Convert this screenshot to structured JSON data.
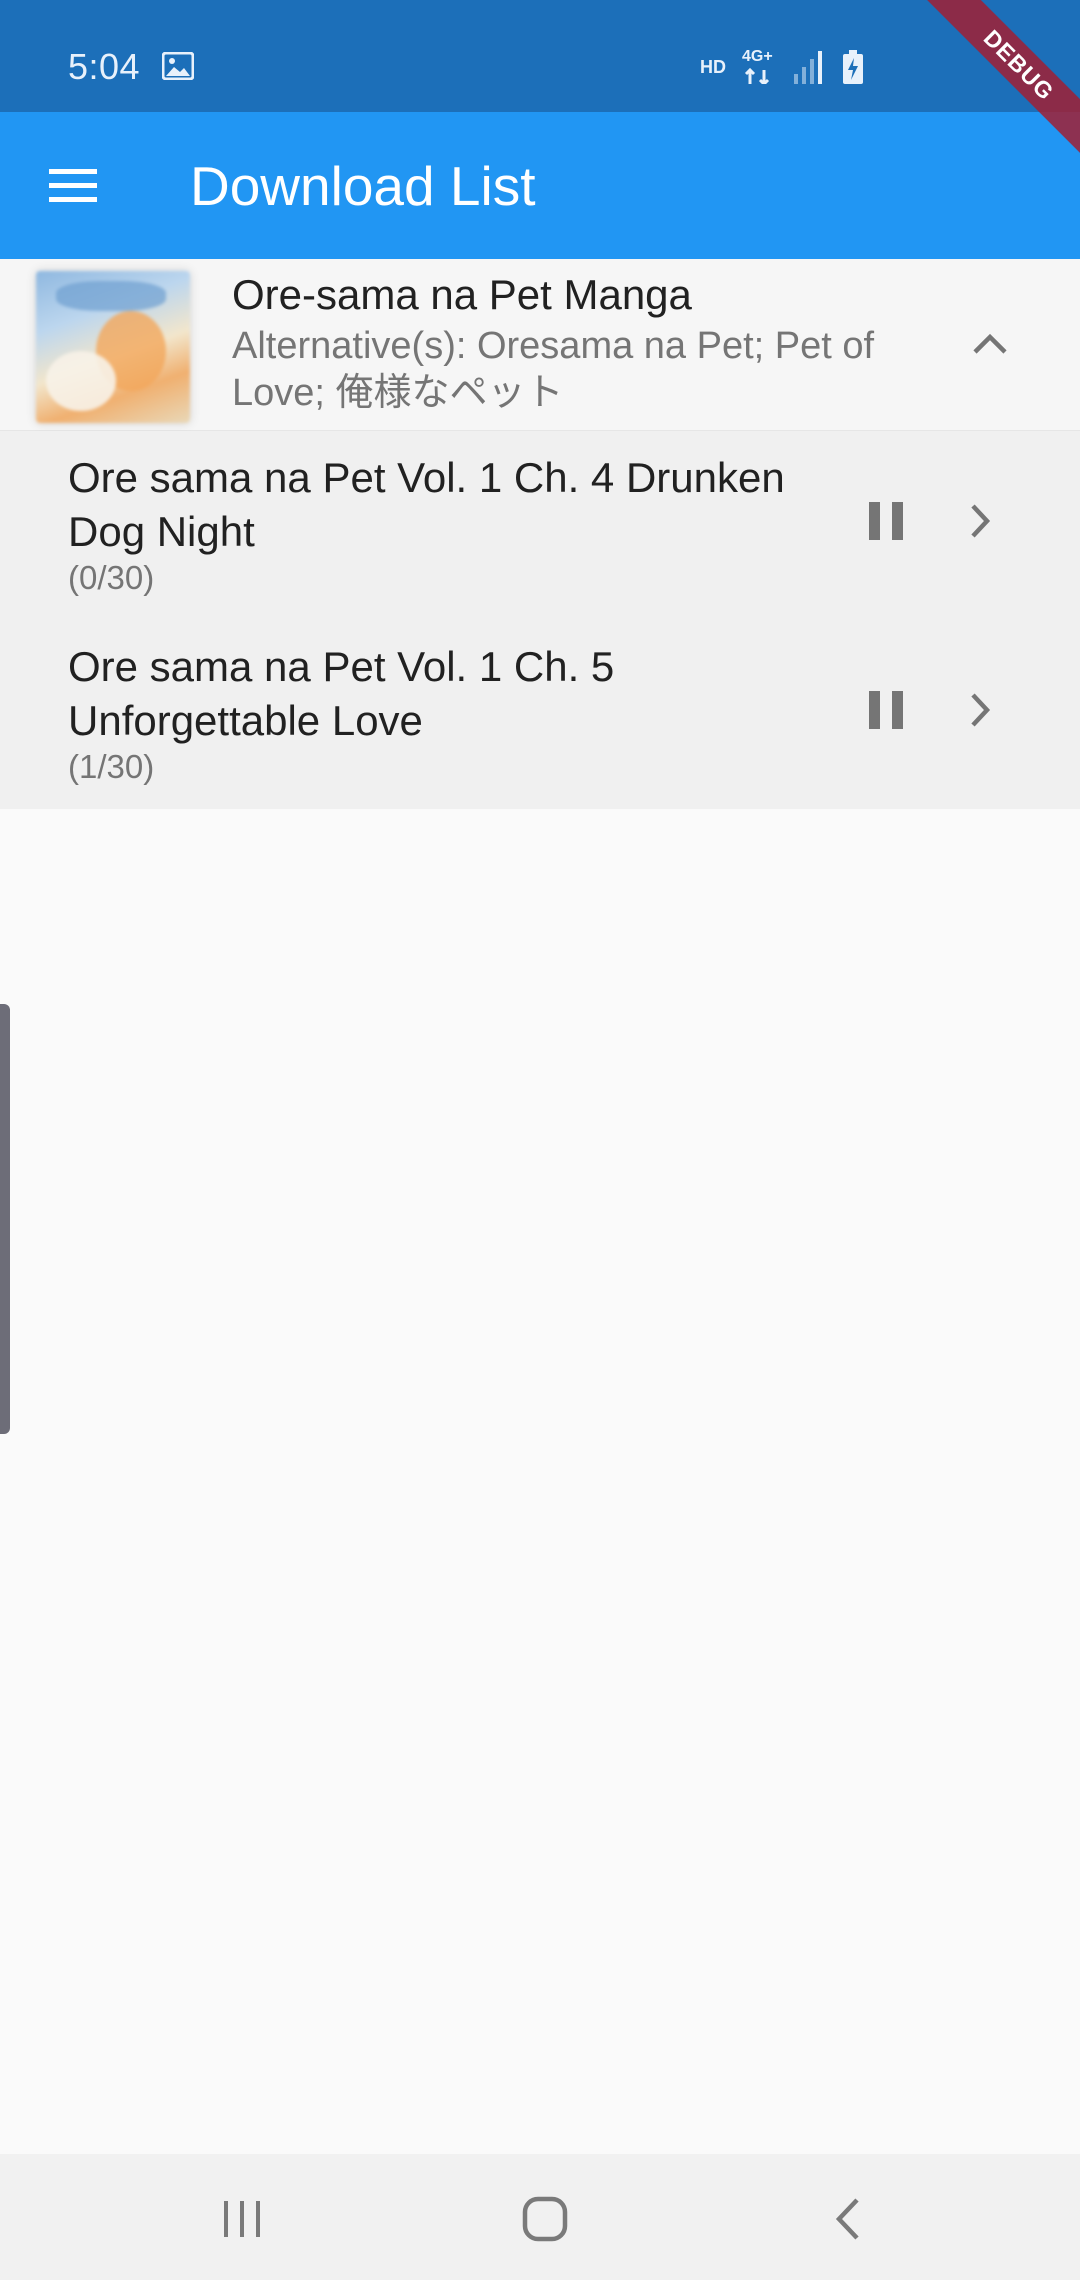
{
  "status_bar": {
    "time": "5:04",
    "hd_label": "HD",
    "network_label": "4G+"
  },
  "debug_banner": "DEBUG",
  "app_bar": {
    "title": "Download List"
  },
  "manga": {
    "title": "Ore-sama na Pet Manga",
    "alternatives": "Alternative(s): Oresama na Pet; Pet of Love; 俺様なペット",
    "expanded": true
  },
  "chapters": [
    {
      "title": "Ore sama na Pet Vol. 1 Ch. 4 Drunken Dog Night",
      "progress": "(0/30)"
    },
    {
      "title": "Ore sama na Pet Vol. 1 Ch. 5 Unforgettable Love",
      "progress": "(1/30)"
    }
  ],
  "colors": {
    "status_bar": "#1c6fb9",
    "app_bar": "#2196f3",
    "debug_banner": "#a02034",
    "list_background": "#f0f0f0"
  },
  "icons": {
    "menu": "menu-icon",
    "collapse": "chevron-up-icon",
    "pause": "pause-icon",
    "open": "chevron-right-icon",
    "nav_recents": "recents-icon",
    "nav_home": "home-icon",
    "nav_back": "back-icon"
  }
}
